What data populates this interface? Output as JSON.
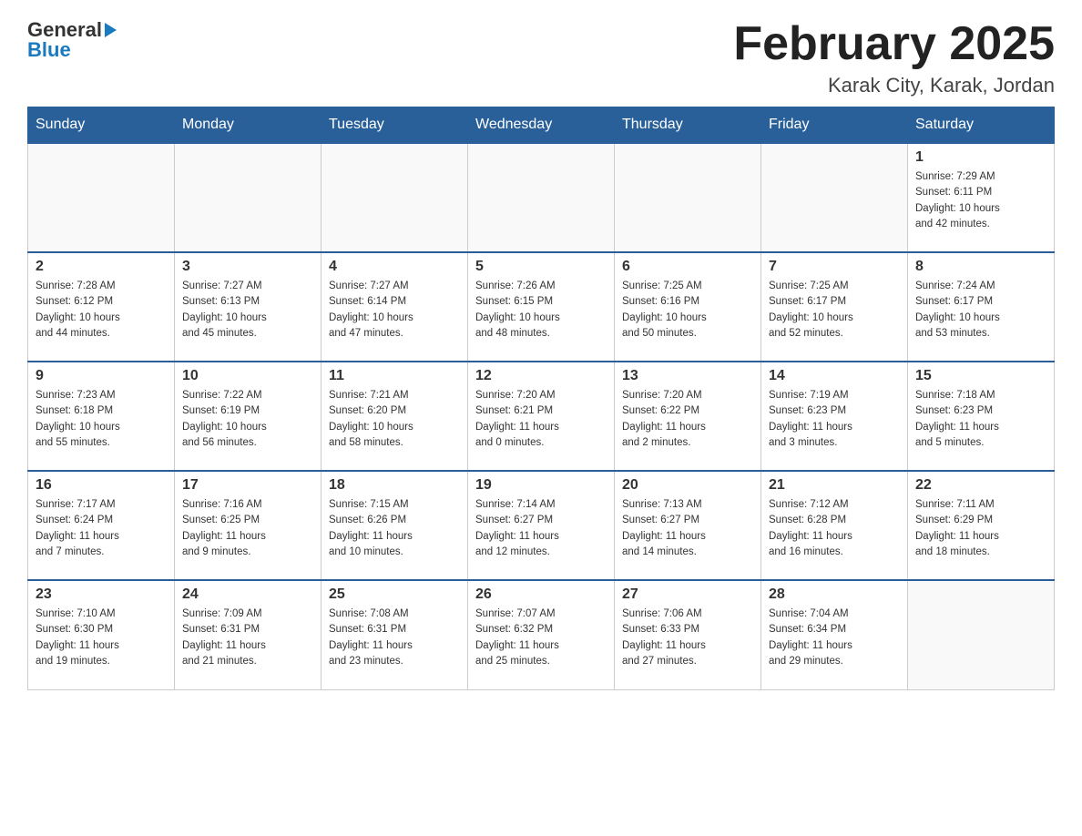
{
  "header": {
    "title": "February 2025",
    "location": "Karak City, Karak, Jordan"
  },
  "logo": {
    "general": "General",
    "blue": "Blue"
  },
  "days": [
    "Sunday",
    "Monday",
    "Tuesday",
    "Wednesday",
    "Thursday",
    "Friday",
    "Saturday"
  ],
  "weeks": [
    [
      {
        "day": "",
        "info": ""
      },
      {
        "day": "",
        "info": ""
      },
      {
        "day": "",
        "info": ""
      },
      {
        "day": "",
        "info": ""
      },
      {
        "day": "",
        "info": ""
      },
      {
        "day": "",
        "info": ""
      },
      {
        "day": "1",
        "info": "Sunrise: 7:29 AM\nSunset: 6:11 PM\nDaylight: 10 hours\nand 42 minutes."
      }
    ],
    [
      {
        "day": "2",
        "info": "Sunrise: 7:28 AM\nSunset: 6:12 PM\nDaylight: 10 hours\nand 44 minutes."
      },
      {
        "day": "3",
        "info": "Sunrise: 7:27 AM\nSunset: 6:13 PM\nDaylight: 10 hours\nand 45 minutes."
      },
      {
        "day": "4",
        "info": "Sunrise: 7:27 AM\nSunset: 6:14 PM\nDaylight: 10 hours\nand 47 minutes."
      },
      {
        "day": "5",
        "info": "Sunrise: 7:26 AM\nSunset: 6:15 PM\nDaylight: 10 hours\nand 48 minutes."
      },
      {
        "day": "6",
        "info": "Sunrise: 7:25 AM\nSunset: 6:16 PM\nDaylight: 10 hours\nand 50 minutes."
      },
      {
        "day": "7",
        "info": "Sunrise: 7:25 AM\nSunset: 6:17 PM\nDaylight: 10 hours\nand 52 minutes."
      },
      {
        "day": "8",
        "info": "Sunrise: 7:24 AM\nSunset: 6:17 PM\nDaylight: 10 hours\nand 53 minutes."
      }
    ],
    [
      {
        "day": "9",
        "info": "Sunrise: 7:23 AM\nSunset: 6:18 PM\nDaylight: 10 hours\nand 55 minutes."
      },
      {
        "day": "10",
        "info": "Sunrise: 7:22 AM\nSunset: 6:19 PM\nDaylight: 10 hours\nand 56 minutes."
      },
      {
        "day": "11",
        "info": "Sunrise: 7:21 AM\nSunset: 6:20 PM\nDaylight: 10 hours\nand 58 minutes."
      },
      {
        "day": "12",
        "info": "Sunrise: 7:20 AM\nSunset: 6:21 PM\nDaylight: 11 hours\nand 0 minutes."
      },
      {
        "day": "13",
        "info": "Sunrise: 7:20 AM\nSunset: 6:22 PM\nDaylight: 11 hours\nand 2 minutes."
      },
      {
        "day": "14",
        "info": "Sunrise: 7:19 AM\nSunset: 6:23 PM\nDaylight: 11 hours\nand 3 minutes."
      },
      {
        "day": "15",
        "info": "Sunrise: 7:18 AM\nSunset: 6:23 PM\nDaylight: 11 hours\nand 5 minutes."
      }
    ],
    [
      {
        "day": "16",
        "info": "Sunrise: 7:17 AM\nSunset: 6:24 PM\nDaylight: 11 hours\nand 7 minutes."
      },
      {
        "day": "17",
        "info": "Sunrise: 7:16 AM\nSunset: 6:25 PM\nDaylight: 11 hours\nand 9 minutes."
      },
      {
        "day": "18",
        "info": "Sunrise: 7:15 AM\nSunset: 6:26 PM\nDaylight: 11 hours\nand 10 minutes."
      },
      {
        "day": "19",
        "info": "Sunrise: 7:14 AM\nSunset: 6:27 PM\nDaylight: 11 hours\nand 12 minutes."
      },
      {
        "day": "20",
        "info": "Sunrise: 7:13 AM\nSunset: 6:27 PM\nDaylight: 11 hours\nand 14 minutes."
      },
      {
        "day": "21",
        "info": "Sunrise: 7:12 AM\nSunset: 6:28 PM\nDaylight: 11 hours\nand 16 minutes."
      },
      {
        "day": "22",
        "info": "Sunrise: 7:11 AM\nSunset: 6:29 PM\nDaylight: 11 hours\nand 18 minutes."
      }
    ],
    [
      {
        "day": "23",
        "info": "Sunrise: 7:10 AM\nSunset: 6:30 PM\nDaylight: 11 hours\nand 19 minutes."
      },
      {
        "day": "24",
        "info": "Sunrise: 7:09 AM\nSunset: 6:31 PM\nDaylight: 11 hours\nand 21 minutes."
      },
      {
        "day": "25",
        "info": "Sunrise: 7:08 AM\nSunset: 6:31 PM\nDaylight: 11 hours\nand 23 minutes."
      },
      {
        "day": "26",
        "info": "Sunrise: 7:07 AM\nSunset: 6:32 PM\nDaylight: 11 hours\nand 25 minutes."
      },
      {
        "day": "27",
        "info": "Sunrise: 7:06 AM\nSunset: 6:33 PM\nDaylight: 11 hours\nand 27 minutes."
      },
      {
        "day": "28",
        "info": "Sunrise: 7:04 AM\nSunset: 6:34 PM\nDaylight: 11 hours\nand 29 minutes."
      },
      {
        "day": "",
        "info": ""
      }
    ]
  ]
}
